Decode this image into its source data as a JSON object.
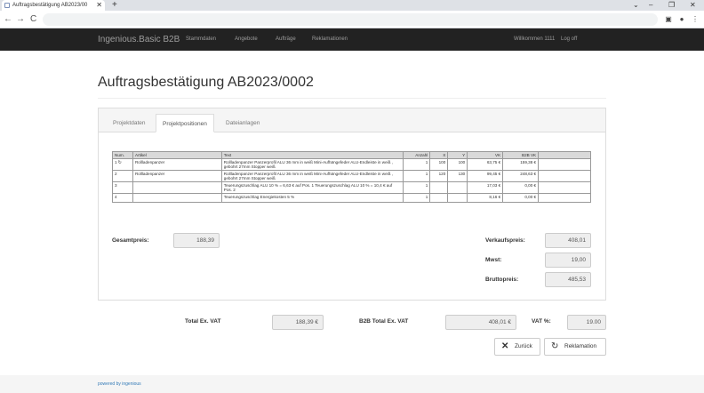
{
  "browser": {
    "tab_title": "Auftragsbestätigung AB2023/00",
    "tab_close_icon": "close-icon",
    "new_tab_label": "+",
    "back_label": "←",
    "forward_label": "→",
    "reload_label": "C",
    "window_controls": [
      "⌄",
      "–",
      "❐",
      "✕"
    ]
  },
  "navbar": {
    "brand": "Ingenious.Basic B2B",
    "links": [
      "Stammdaten",
      "Angebote",
      "Aufträge",
      "Reklamationen"
    ],
    "welcome": "Willkommen 1111",
    "logout": "Log off"
  },
  "page": {
    "title": "Auftragsbestätigung AB2023/0002"
  },
  "tabs": [
    {
      "label": "Projektdaten",
      "active": false
    },
    {
      "label": "Projektpositionen",
      "active": true
    },
    {
      "label": "Dateianlagen",
      "active": false
    }
  ],
  "table": {
    "headers": [
      "Num.",
      "Artikel",
      "Text",
      "Anzahl",
      "X",
      "Y",
      "VK",
      "B2B VK",
      ""
    ],
    "rows": [
      {
        "num": "1",
        "icon": "reload-icon",
        "artikel": "Rollladenpanzer",
        "text": "Rollladenpanzer Panzerprofil ALU 36 mm in weiß Mini-Aufhängefeder ALU-Endleiste in weiß , gebohrt 27mm Stopper weiß",
        "anzahl": "1",
        "x": "100",
        "y": "100",
        "vk": "63,75 €",
        "b2b_vk": "159,38 €"
      },
      {
        "num": "2",
        "icon": "",
        "artikel": "Rollladenpanzer",
        "text": "Rollladenpanzer Panzerprofil ALU 36 mm in weiß Mini-Aufhängefeder ALU-Endleiste in weiß , gebohrt 27mm Stopper weiß",
        "anzahl": "1",
        "x": "120",
        "y": "130",
        "vk": "99,45 €",
        "b2b_vk": "248,63 €"
      },
      {
        "num": "3",
        "icon": "",
        "artikel": "",
        "text": "Teuerungszuschlag ALU 10 % = 6,63 € auf Pos. 1 Teuerungszuschlag ALU 10 % = 10,4 € auf Pos. 2",
        "anzahl": "1",
        "x": "",
        "y": "",
        "vk": "17,03 €",
        "b2b_vk": "0,00 €"
      },
      {
        "num": "4",
        "icon": "",
        "artikel": "",
        "text": "Teuerungszuschlag Energiekosten 5 %",
        "anzahl": "1",
        "x": "",
        "y": "",
        "vk": "8,16 €",
        "b2b_vk": "0,00 €"
      }
    ]
  },
  "summary": {
    "gesamtpreis_label": "Gesamtpreis:",
    "gesamtpreis_value": "188,39",
    "verkaufspreis_label": "Verkaufspreis:",
    "verkaufspreis_value": "408,01",
    "mwst_label": "Mwst:",
    "mwst_value": "19,00",
    "bruttopreis_label": "Bruttopreis:",
    "bruttopreis_value": "485,53"
  },
  "totals": {
    "total_ex_vat_label": "Total Ex. VAT",
    "total_ex_vat_value": "188,39 €",
    "b2b_total_label": "B2B Total Ex. VAT",
    "b2b_total_value": "408,01 €",
    "vat_label": "VAT %:",
    "vat_value": "19.00"
  },
  "buttons": {
    "back": "Zurück",
    "reklamation": "Reklamation"
  },
  "footer": {
    "text": "powered by ingenious"
  }
}
